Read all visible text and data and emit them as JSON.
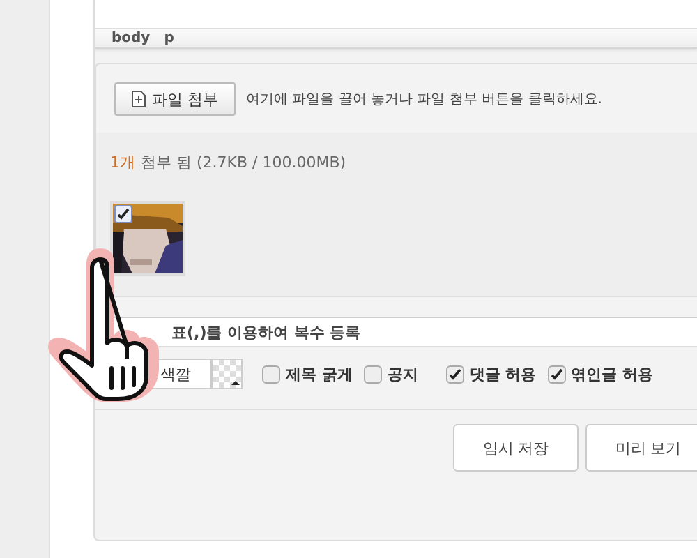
{
  "status_bar": {
    "path": [
      "body",
      "p"
    ]
  },
  "attach": {
    "button": "파일 첨부",
    "hint": "여기에 파일을 끌어 놓거나 파일 첨부 버튼을 클릭하세요.",
    "count": "1개",
    "summary": "첨부 됨 (2.7KB / 100.00MB)",
    "files": [
      {
        "kind": "picture",
        "checked": true
      }
    ]
  },
  "tag_field": {
    "placeholder": "표(,)를 이용하여 복수 등록"
  },
  "title_color": {
    "value": "색깔"
  },
  "options": [
    {
      "label": "제목 굵게",
      "checked": false
    },
    {
      "label": "공지",
      "checked": false
    },
    {
      "label": "댓글 허용",
      "checked": true
    },
    {
      "label": "엮인글 허용",
      "checked": true
    }
  ],
  "buttons": [
    "임시 저장",
    "미리 보기"
  ]
}
